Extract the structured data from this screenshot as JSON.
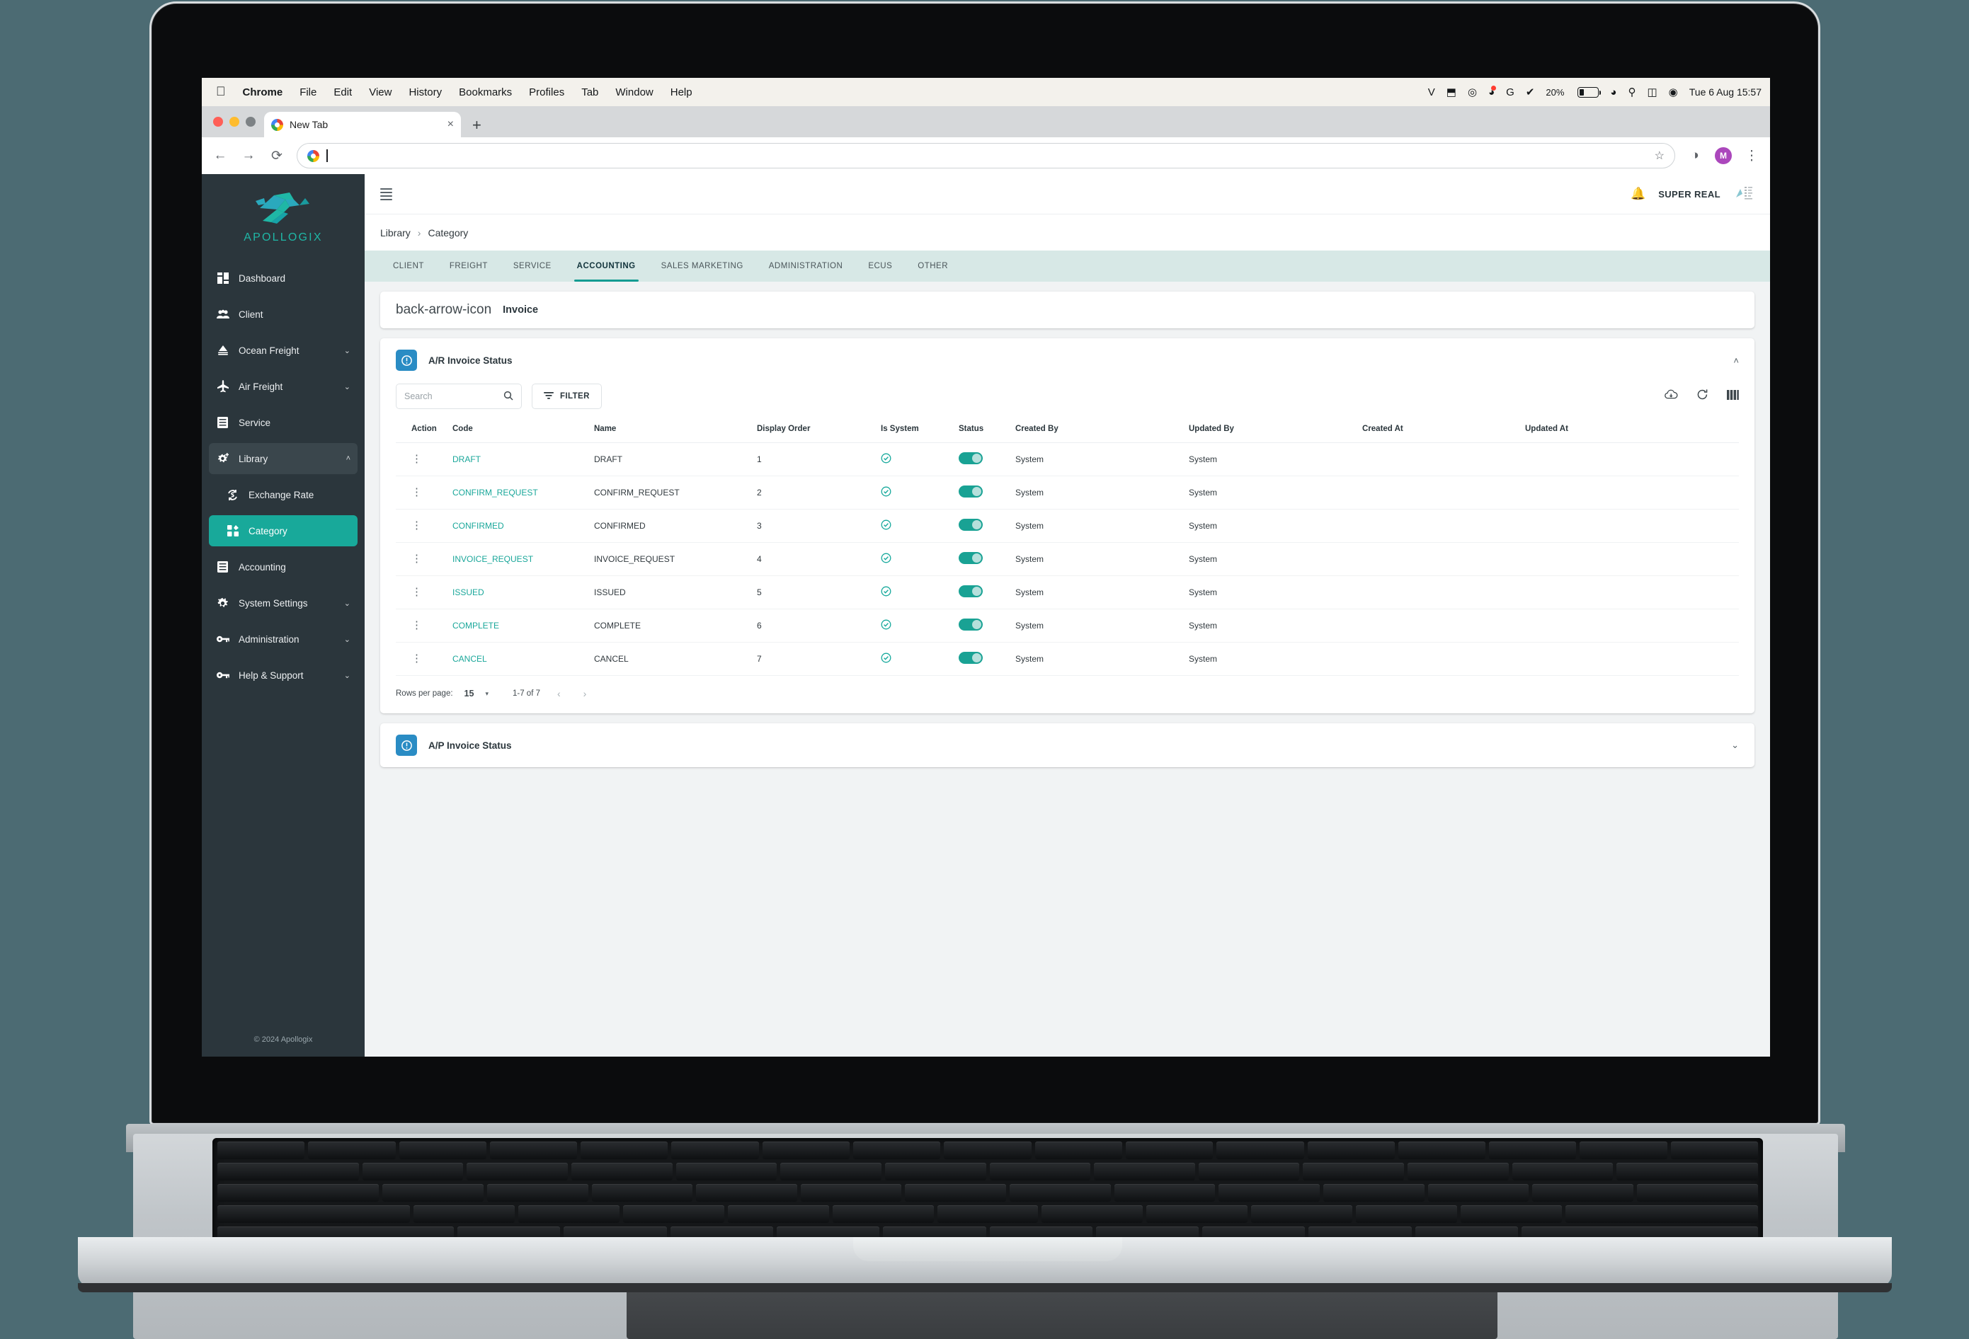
{
  "macbar": {
    "apple_icon": "apple-icon",
    "menus": [
      "Chrome",
      "File",
      "Edit",
      "View",
      "History",
      "Bookmarks",
      "Profiles",
      "Tab",
      "Window",
      "Help"
    ],
    "tray": [
      {
        "name": "vpn-v-icon",
        "glyph": "V"
      },
      {
        "name": "resize-icon",
        "glyph": "⬒"
      },
      {
        "name": "cloud-sync-icon",
        "glyph": "◎"
      },
      {
        "name": "messages-icon",
        "glyph": "◕"
      },
      {
        "name": "grammarly-icon",
        "glyph": "G"
      },
      {
        "name": "checkmark-shield-icon",
        "glyph": "✔"
      }
    ],
    "battery_percent": "20%",
    "wifi_icon": "wifi-icon",
    "spotlight_icon": "search-icon",
    "control_center_icon": "control-center-icon",
    "siri_icon": "siri-icon",
    "clock": "Tue 6 Aug  15:57"
  },
  "chrome": {
    "tab_title": "New Tab",
    "tab_close": "×",
    "new_tab": "+",
    "back": "←",
    "forward": "→",
    "reload": "⟳",
    "url_value": "",
    "url_placeholder": "",
    "star": "☆",
    "profile_initial": "M"
  },
  "sidebar": {
    "logo_name": "APOLLOGIX",
    "items": [
      {
        "label": "Dashboard",
        "icon": "dashboard-icon",
        "expandable": false,
        "state": ""
      },
      {
        "label": "Client",
        "icon": "people-icon",
        "expandable": false,
        "state": ""
      },
      {
        "label": "Ocean Freight",
        "icon": "ship-icon",
        "expandable": true,
        "state": ""
      },
      {
        "label": "Air Freight",
        "icon": "plane-icon",
        "expandable": true,
        "state": ""
      },
      {
        "label": "Service",
        "icon": "document-icon",
        "expandable": false,
        "state": ""
      },
      {
        "label": "Library",
        "icon": "gear-plus-icon",
        "expandable": true,
        "state": "expanded"
      },
      {
        "label": "Exchange Rate",
        "icon": "exchange-icon",
        "expandable": false,
        "state": "sub"
      },
      {
        "label": "Category",
        "icon": "category-icon",
        "expandable": false,
        "state": "active-sub"
      },
      {
        "label": "Accounting",
        "icon": "document-icon",
        "expandable": false,
        "state": ""
      },
      {
        "label": "System Settings",
        "icon": "gear-icon",
        "expandable": true,
        "state": ""
      },
      {
        "label": "Administration",
        "icon": "key-icon",
        "expandable": true,
        "state": ""
      },
      {
        "label": "Help & Support",
        "icon": "key-icon",
        "expandable": true,
        "state": ""
      }
    ],
    "chevron_down": "⌄",
    "chevron_up": "˄",
    "footer": "© 2024 Apollogix"
  },
  "topbar": {
    "menu_icon": "hamburger-icon",
    "bell_icon": "bell-icon",
    "company": "SUPER REAL"
  },
  "breadcrumb": {
    "parent": "Library",
    "separator": "›",
    "current": "Category"
  },
  "category_tabs": [
    {
      "label": "CLIENT",
      "selected": false
    },
    {
      "label": "FREIGHT",
      "selected": false
    },
    {
      "label": "SERVICE",
      "selected": false
    },
    {
      "label": "ACCOUNTING",
      "selected": true
    },
    {
      "label": "SALES MARKETING",
      "selected": false
    },
    {
      "label": "ADMINISTRATION",
      "selected": false
    },
    {
      "label": "ECUS",
      "selected": false
    },
    {
      "label": "OTHER",
      "selected": false
    }
  ],
  "invoice_header": {
    "back_icon": "back-arrow-icon",
    "title": "Invoice"
  },
  "ar_panel": {
    "icon": "info-circle-icon",
    "title": "A/R Invoice Status",
    "collapse_chevron": "˄",
    "search_placeholder": "Search",
    "search_value": "",
    "search_icon": "search-icon",
    "filter_label": "FILTER",
    "filter_icon": "filter-icon",
    "actions": [
      {
        "name": "cloud-download-icon",
        "glyph": "☁"
      },
      {
        "name": "refresh-icon",
        "glyph": "⟳"
      },
      {
        "name": "columns-icon",
        "glyph": "▐▐▐"
      }
    ],
    "columns": [
      "Action",
      "Code",
      "Name",
      "Display Order",
      "Is System",
      "Status",
      "Created By",
      "Updated By",
      "Created At",
      "Updated At"
    ],
    "rows": [
      {
        "action": "⋮",
        "code": "DRAFT",
        "name": "DRAFT",
        "display_order": "1",
        "is_system": true,
        "status": true,
        "created_by": "System",
        "updated_by": "System",
        "created_at": "",
        "updated_at": ""
      },
      {
        "action": "⋮",
        "code": "CONFIRM_REQUEST",
        "name": "CONFIRM_REQUEST",
        "display_order": "2",
        "is_system": true,
        "status": true,
        "created_by": "System",
        "updated_by": "System",
        "created_at": "",
        "updated_at": ""
      },
      {
        "action": "⋮",
        "code": "CONFIRMED",
        "name": "CONFIRMED",
        "display_order": "3",
        "is_system": true,
        "status": true,
        "created_by": "System",
        "updated_by": "System",
        "created_at": "",
        "updated_at": ""
      },
      {
        "action": "⋮",
        "code": "INVOICE_REQUEST",
        "name": "INVOICE_REQUEST",
        "display_order": "4",
        "is_system": true,
        "status": true,
        "created_by": "System",
        "updated_by": "System",
        "created_at": "",
        "updated_at": ""
      },
      {
        "action": "⋮",
        "code": "ISSUED",
        "name": "ISSUED",
        "display_order": "5",
        "is_system": true,
        "status": true,
        "created_by": "System",
        "updated_by": "System",
        "created_at": "",
        "updated_at": ""
      },
      {
        "action": "⋮",
        "code": "COMPLETE",
        "name": "COMPLETE",
        "display_order": "6",
        "is_system": true,
        "status": true,
        "created_by": "System",
        "updated_by": "System",
        "created_at": "",
        "updated_at": ""
      },
      {
        "action": "⋮",
        "code": "CANCEL",
        "name": "CANCEL",
        "display_order": "7",
        "is_system": true,
        "status": true,
        "created_by": "System",
        "updated_by": "System",
        "created_at": "",
        "updated_at": ""
      }
    ],
    "pager": {
      "rows_label": "Rows per page:",
      "rows_value": "15",
      "rows_arrow": "▾",
      "range": "1-7 of 7",
      "prev": "‹",
      "next": "›"
    }
  },
  "ap_panel": {
    "icon": "info-circle-icon",
    "title": "A/P Invoice Status",
    "expand_chevron": "⌄"
  },
  "colors": {
    "accent_teal": "#19a294",
    "sidebar_bg": "#2b363c",
    "tabs_bg": "#d7e8e6",
    "panel_icon_blue": "#2a8cc4",
    "code_link": "#1aa79a",
    "desktop_bg": "#4c6b73"
  }
}
